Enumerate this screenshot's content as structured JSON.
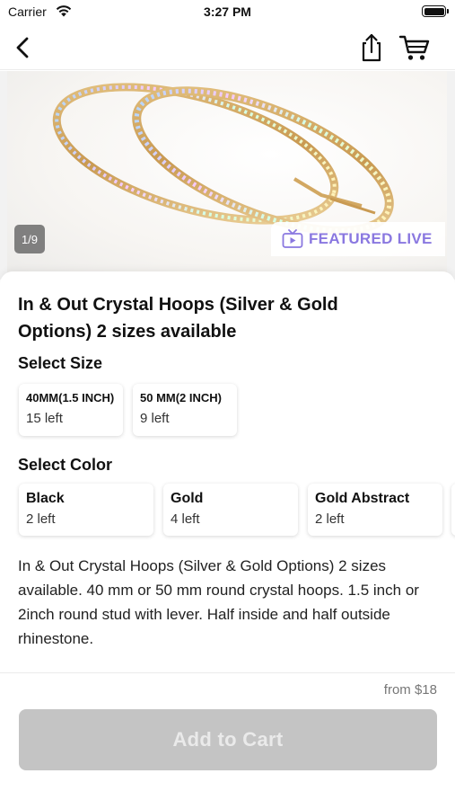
{
  "status_bar": {
    "carrier": "Carrier",
    "time": "3:27 PM"
  },
  "nav": {
    "back_icon": "chevron-left-icon",
    "share_icon": "share-icon",
    "cart_icon": "cart-icon"
  },
  "gallery": {
    "page_indicator": "1/9",
    "badge_icon": "tv-icon",
    "badge_label": "FEATURED LIVE",
    "badge_color": "#8a78e0"
  },
  "product": {
    "title": "In & Out Crystal Hoops (Silver & Gold Options) 2 sizes available",
    "size_label": "Select Size",
    "sizes": [
      {
        "name": "40MM(1.5 INCH)",
        "stock": "15 left"
      },
      {
        "name": "50 MM(2 INCH)",
        "stock": "9 left"
      }
    ],
    "color_label": "Select Color",
    "colors": [
      {
        "name": "Black",
        "stock": "2 left"
      },
      {
        "name": "Gold",
        "stock": "4 left"
      },
      {
        "name": "Gold Abstract",
        "stock": "2 left"
      }
    ],
    "description": "In & Out Crystal Hoops (Silver & Gold Options) 2 sizes available. 40 mm or 50 mm round crystal hoops. 1.5 inch or 2inch round stud with lever. Half inside and half outside rhinestone."
  },
  "footer": {
    "price": "from $18",
    "add_to_cart_label": "Add to Cart",
    "button_color": "#c4c4c4"
  }
}
